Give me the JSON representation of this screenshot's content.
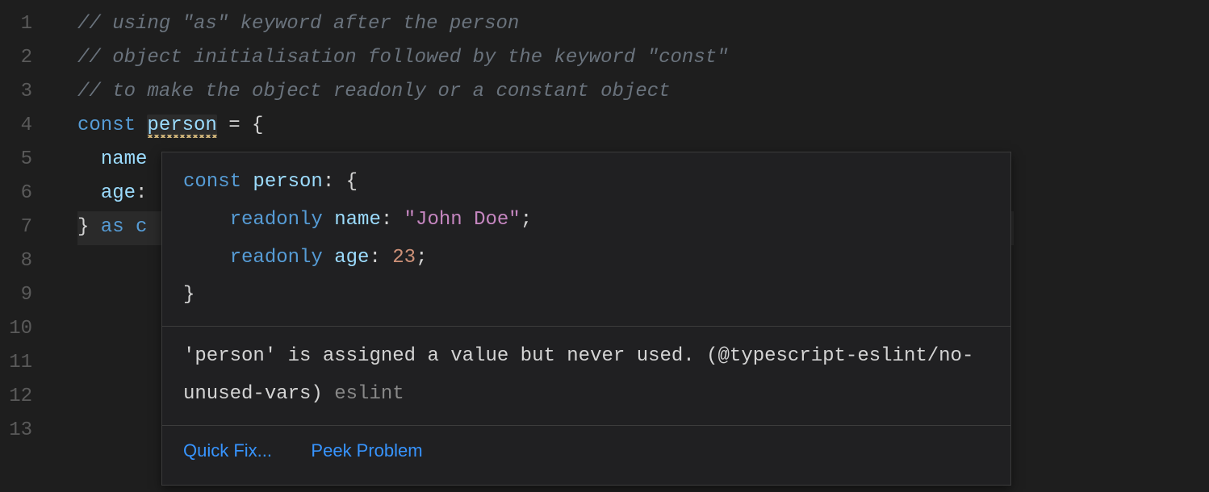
{
  "lines": {
    "l1": {
      "num": "1",
      "comment": "// using \"as\" keyword after the person"
    },
    "l2": {
      "num": "2",
      "comment": "// object initialisation followed by the keyword \"const\""
    },
    "l3": {
      "num": "3",
      "comment": "// to make the object readonly or a constant object"
    },
    "l4": {
      "num": "4",
      "kw": "const",
      "ident": "person",
      "rest": " = {"
    },
    "l5": {
      "num": "5",
      "indent": "  ",
      "prop": "name"
    },
    "l6": {
      "num": "6",
      "indent": "  ",
      "prop": "age",
      "colon": ":"
    },
    "l7": {
      "num": "7",
      "brace": "}",
      "as": " as ",
      "kw2": "c"
    },
    "l8": {
      "num": "8"
    },
    "l9": {
      "num": "9"
    },
    "l10": {
      "num": "10"
    },
    "l11": {
      "num": "11"
    },
    "l12": {
      "num": "12"
    },
    "l13": {
      "num": "13"
    }
  },
  "hover": {
    "sig": {
      "const": "const",
      "ident": " person",
      "colon": ": ",
      "brace_open": "{",
      "indent": "    ",
      "readonly": "readonly",
      "name_key": " name",
      "name_colon": ": ",
      "name_val": "\"John Doe\"",
      "semi": ";",
      "age_key": " age",
      "age_colon": ": ",
      "age_val": "23",
      "brace_close": "}"
    },
    "message": "'person' is assigned a value but never used. (@typescript-eslint/no-unused-vars)",
    "source": " eslint",
    "quickfix": "Quick Fix...",
    "peek": "Peek Problem"
  }
}
